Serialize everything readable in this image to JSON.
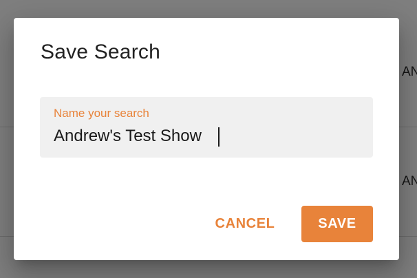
{
  "background": {
    "cells": [
      "AN",
      "AN"
    ]
  },
  "dialog": {
    "title": "Save Search",
    "field": {
      "label": "Name your search",
      "value": "Andrew's Test Show"
    },
    "actions": {
      "cancel_label": "CANCEL",
      "save_label": "SAVE"
    }
  },
  "colors": {
    "accent": "#e8833a",
    "scrim": "rgba(0,0,0,0.5)",
    "field_bg": "#f0f0f0"
  }
}
